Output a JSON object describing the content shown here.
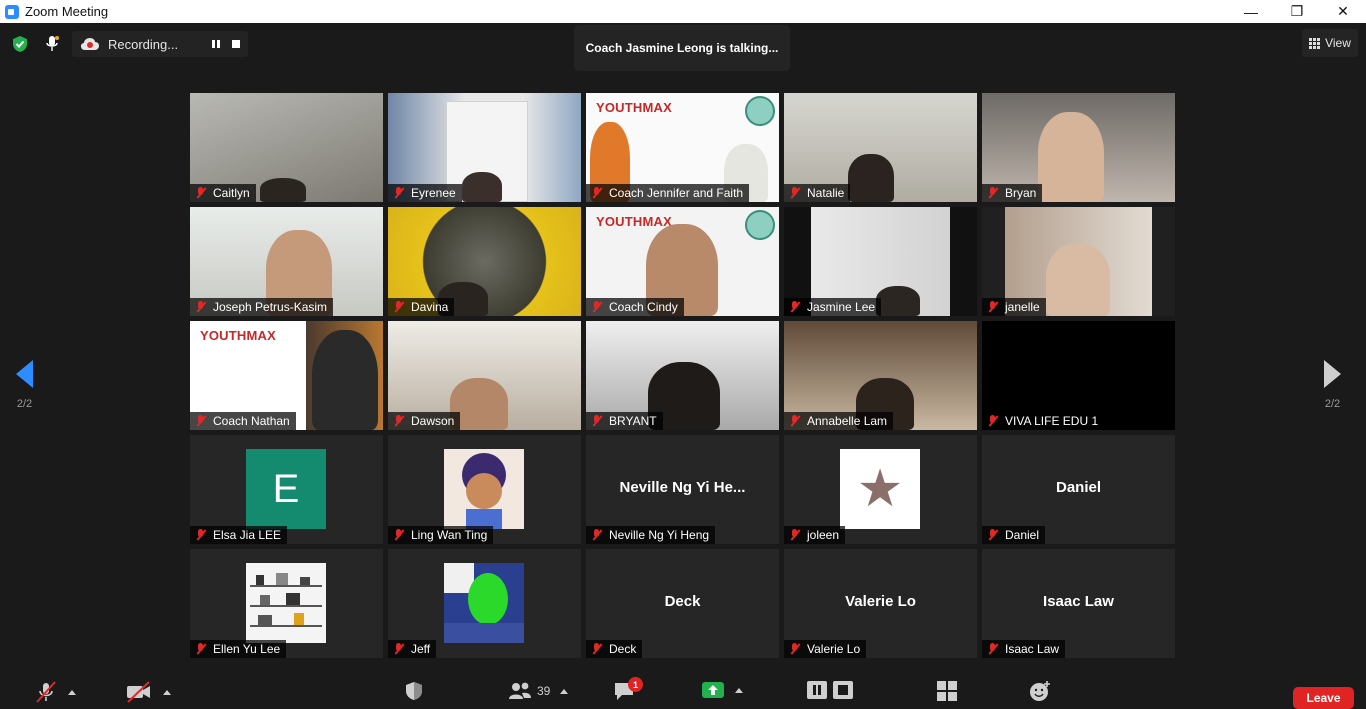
{
  "window": {
    "title": "Zoom Meeting",
    "minimize": "—",
    "restore": "❐",
    "close": "✕"
  },
  "topbar": {
    "recording_text": "Recording...",
    "talking_text": "Coach Jasmine Leong is talking...",
    "view_label": "View"
  },
  "pager": {
    "left_label": "2/2",
    "right_label": "2/2"
  },
  "tiles": [
    {
      "name": "Caitlyn",
      "kind": "video"
    },
    {
      "name": "Eyrenee",
      "kind": "video"
    },
    {
      "name": "Coach Jennifer and Faith",
      "kind": "video",
      "brand": "YOUTHMAX"
    },
    {
      "name": "Natalie",
      "kind": "video"
    },
    {
      "name": "Bryan",
      "kind": "video"
    },
    {
      "name": "Joseph Petrus-Kasim",
      "kind": "video"
    },
    {
      "name": "Davina",
      "kind": "video"
    },
    {
      "name": "Coach Cindy",
      "kind": "video",
      "brand": "YOUTHMAX"
    },
    {
      "name": "Jasmine Lee",
      "kind": "video"
    },
    {
      "name": "janelle",
      "kind": "video"
    },
    {
      "name": "Coach Nathan",
      "kind": "video",
      "brand": "YOUTHMAX"
    },
    {
      "name": "Dawson",
      "kind": "video"
    },
    {
      "name": "BRYANT",
      "kind": "video"
    },
    {
      "name": "Annabelle Lam",
      "kind": "video"
    },
    {
      "name": "VIVA LIFE EDU 1",
      "kind": "video"
    },
    {
      "name": "Elsa Jia LEE",
      "kind": "avatar",
      "avatar_letter": "E"
    },
    {
      "name": "Ling Wan Ting",
      "kind": "avatar"
    },
    {
      "name": "Neville Ng Yi Heng",
      "kind": "text",
      "display": "Neville Ng Yi He..."
    },
    {
      "name": "joleen",
      "kind": "avatar",
      "avatar_glyph": "★"
    },
    {
      "name": "Daniel",
      "kind": "text",
      "display": "Daniel"
    },
    {
      "name": "Ellen Yu Lee",
      "kind": "avatar"
    },
    {
      "name": "Jeff",
      "kind": "avatar"
    },
    {
      "name": "Deck",
      "kind": "text",
      "display": "Deck"
    },
    {
      "name": "Valerie  Lo",
      "kind": "text",
      "display": "Valerie  Lo"
    },
    {
      "name": "Isaac Law",
      "kind": "text",
      "display": "Isaac Law"
    }
  ],
  "toolbar": {
    "participants_count": "39",
    "chat_badge": "1",
    "leave_label": "Leave"
  },
  "colors": {
    "accent": "#2d8cff",
    "muted": "#e02828",
    "leave": "#e02424",
    "share": "#22b14c",
    "badge_green": "#22b14c"
  }
}
